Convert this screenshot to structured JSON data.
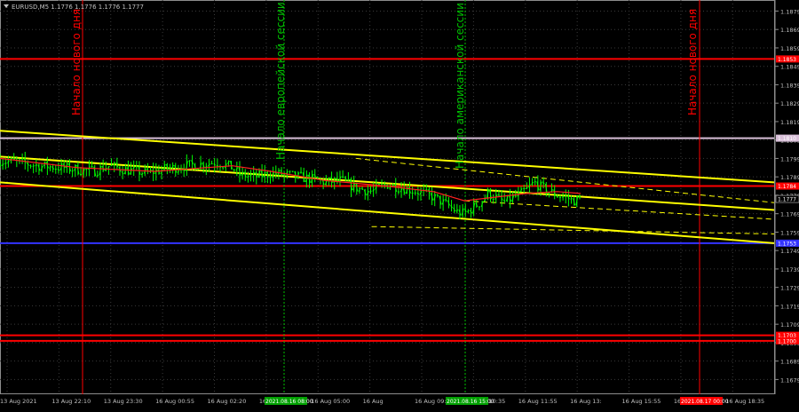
{
  "header": {
    "symbol_quote": "EURUSD,M5  1.1776 1.1776 1.1776 1.1777"
  },
  "annotations": {
    "new_day": "Начало нового дня",
    "european_session": "Начало европейской сессии",
    "american_session": "Начало американской сессии"
  },
  "colors": {
    "background": "#000000",
    "candle": "#00ff00",
    "trend_line": "#ffff00",
    "ma_line": "#ff2020",
    "level_red": "#ff0000",
    "level_blue": "#3333ff",
    "level_lilac": "#d8bfd8",
    "session_line": "#00c000",
    "day_line": "#ff0000",
    "axis_text": "#c0c0c0"
  },
  "chart_data": {
    "type": "candlestick",
    "symbol": "EURUSD",
    "timeframe": "M5",
    "last_price": 1.1777,
    "ylim": [
      1.1671,
      1.1885
    ],
    "y_ticks": [
      1.1879,
      1.1869,
      1.1859,
      1.1849,
      1.1839,
      1.1829,
      1.1819,
      1.1809,
      1.1799,
      1.1789,
      1.1779,
      1.1769,
      1.1759,
      1.1749,
      1.1739,
      1.1729,
      1.1719,
      1.1709,
      1.1699,
      1.1689,
      1.1679
    ],
    "x_labels": [
      "13 Aug 2021",
      "13 Aug 22:10",
      "13 Aug 23:30",
      "16 Aug 00:55",
      "16 Aug 02:20",
      "16 Aug 03:40",
      "16 Aug 05:00",
      "16 Aug",
      "16 Aug 09:15",
      "16 Aug 10:35",
      "16 Aug 11:55",
      "16 Aug 13:",
      "16 Aug 15:55",
      "16 Aug 17:15",
      "16 Aug 18:35"
    ],
    "time_markers": [
      "2021.08.16 08:00",
      "2021.08.16 15:00",
      "2021.08.17 00:00"
    ],
    "horizontal_levels": [
      {
        "price": 1.1853,
        "label": "1.1853",
        "color": "#ff0000"
      },
      {
        "price": 1.181,
        "label": "1.1810",
        "color": "#d8bfd8"
      },
      {
        "price": 1.1784,
        "label": "1.1784",
        "color": "#ff0000"
      },
      {
        "price": 1.1753,
        "label": "1.1753",
        "color": "#3333ff"
      },
      {
        "price": 1.1703,
        "label": "1.1703",
        "color": "#ff0000"
      },
      {
        "price": 1.17,
        "label": "1.1700",
        "color": "#ff0000"
      }
    ],
    "trend_lines": [
      {
        "from": [
          0,
          1.1814
        ],
        "to": [
          1,
          1.1786
        ]
      },
      {
        "from": [
          0,
          1.18
        ],
        "to": [
          1,
          1.1771
        ]
      },
      {
        "from": [
          0,
          1.1786
        ],
        "to": [
          1,
          1.1753
        ]
      }
    ],
    "close_path": [
      [
        0.0,
        1.1798
      ],
      [
        0.02,
        1.1797
      ],
      [
        0.05,
        1.1795
      ],
      [
        0.08,
        1.1794
      ],
      [
        0.1,
        1.1793
      ],
      [
        0.12,
        1.1792
      ],
      [
        0.14,
        1.1795
      ],
      [
        0.16,
        1.1793
      ],
      [
        0.19,
        1.1791
      ],
      [
        0.21,
        1.1793
      ],
      [
        0.24,
        1.1795
      ],
      [
        0.26,
        1.1796
      ],
      [
        0.28,
        1.1797
      ],
      [
        0.3,
        1.1794
      ],
      [
        0.31,
        1.179
      ],
      [
        0.33,
        1.1789
      ],
      [
        0.35,
        1.1791
      ],
      [
        0.37,
        1.179
      ],
      [
        0.4,
        1.1788
      ],
      [
        0.42,
        1.1786
      ],
      [
        0.44,
        1.1787
      ],
      [
        0.46,
        1.1783
      ],
      [
        0.48,
        1.1781
      ],
      [
        0.5,
        1.1785
      ],
      [
        0.52,
        1.1783
      ],
      [
        0.54,
        1.1781
      ],
      [
        0.56,
        1.1778
      ],
      [
        0.58,
        1.1773
      ],
      [
        0.59,
        1.177
      ],
      [
        0.6,
        1.1769
      ],
      [
        0.61,
        1.1772
      ],
      [
        0.62,
        1.1775
      ],
      [
        0.63,
        1.178
      ],
      [
        0.64,
        1.1778
      ],
      [
        0.65,
        1.1775
      ],
      [
        0.66,
        1.1777
      ],
      [
        0.67,
        1.1779
      ],
      [
        0.68,
        1.1782
      ],
      [
        0.69,
        1.1786
      ],
      [
        0.7,
        1.1783
      ],
      [
        0.71,
        1.1781
      ],
      [
        0.72,
        1.1779
      ],
      [
        0.73,
        1.1778
      ],
      [
        0.74,
        1.1776
      ],
      [
        0.75,
        1.1777
      ]
    ],
    "moving_average": [
      [
        0.0,
        1.1799
      ],
      [
        0.1,
        1.1794
      ],
      [
        0.2,
        1.1792
      ],
      [
        0.3,
        1.1795
      ],
      [
        0.35,
        1.1792
      ],
      [
        0.42,
        1.1787
      ],
      [
        0.5,
        1.1784
      ],
      [
        0.56,
        1.1781
      ],
      [
        0.6,
        1.1776
      ],
      [
        0.64,
        1.1778
      ],
      [
        0.68,
        1.178
      ],
      [
        0.72,
        1.1781
      ],
      [
        0.75,
        1.178
      ]
    ]
  }
}
